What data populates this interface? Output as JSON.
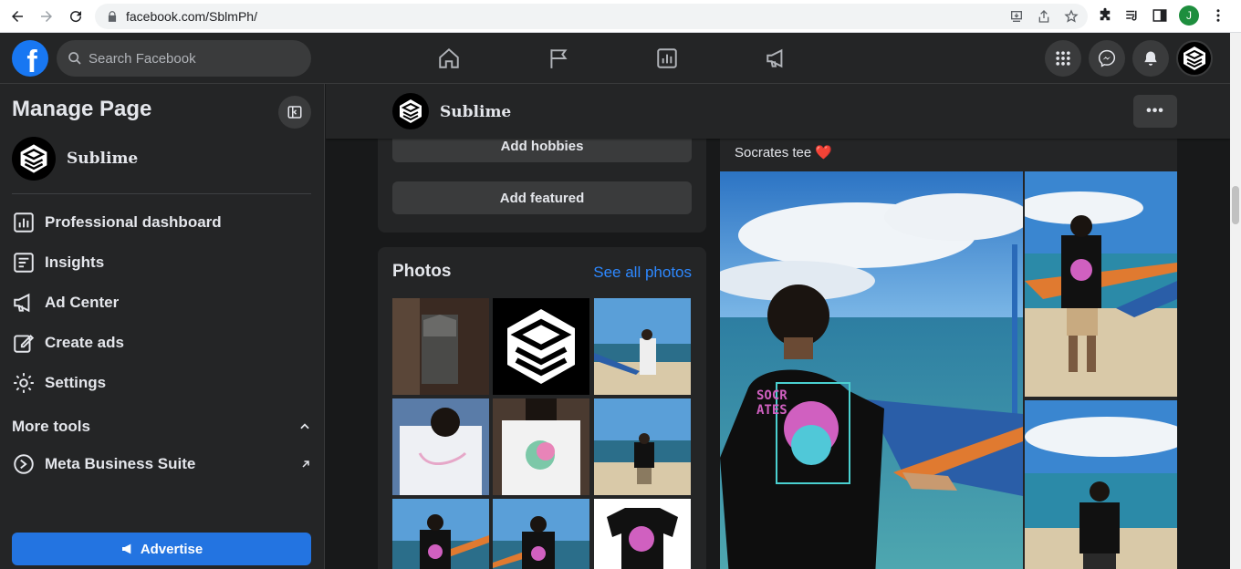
{
  "browser": {
    "url": "facebook.com/SblmPh/",
    "profile_initial": "J"
  },
  "topbar": {
    "search_placeholder": "Search Facebook"
  },
  "sidebar": {
    "title": "Manage Page",
    "page_name": "Sublime",
    "items": [
      {
        "label": "Professional dashboard",
        "icon": "dashboard-icon"
      },
      {
        "label": "Insights",
        "icon": "insights-icon"
      },
      {
        "label": "Ad Center",
        "icon": "megaphone-icon"
      },
      {
        "label": "Create ads",
        "icon": "pencil-icon"
      },
      {
        "label": "Settings",
        "icon": "gear-icon"
      }
    ],
    "more_tools_label": "More tools",
    "meta_business_label": "Meta Business Suite",
    "advertise_label": "Advertise"
  },
  "page_header": {
    "name": "Sublime",
    "more_label": "•••"
  },
  "intro": {
    "add_hobbies_label": "Add hobbies",
    "add_featured_label": "Add featured"
  },
  "photos": {
    "title": "Photos",
    "see_all_label": "See all photos"
  },
  "post": {
    "text": "Socrates tee ❤️"
  },
  "colors": {
    "accent": "#2374e1",
    "link": "#2d88ff",
    "background": "#18191a",
    "surface": "#242526"
  }
}
